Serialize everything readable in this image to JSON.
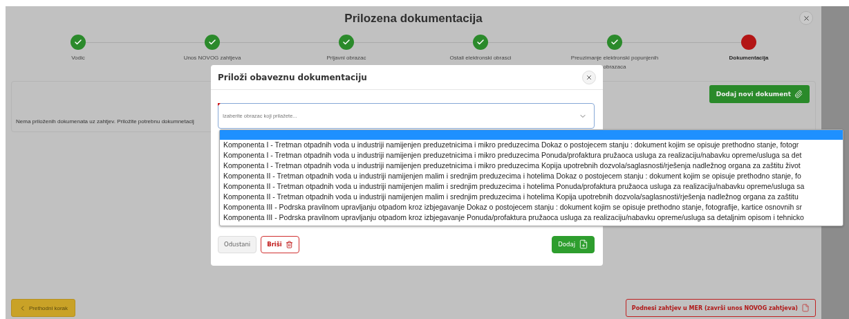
{
  "window": {
    "title": "Prilozena dokumentacija"
  },
  "steps": [
    {
      "label": "Vodic",
      "completed": true,
      "selected": false
    },
    {
      "label": "Unos NOVOG zahtjeva",
      "completed": true,
      "selected": false
    },
    {
      "label": "Prijavni obrazac",
      "completed": true,
      "selected": false
    },
    {
      "label": "Ostali elektronski obrasci",
      "completed": true,
      "selected": false
    },
    {
      "label": "Preuzimanje elektronski popunjenih obrazaca",
      "completed": true,
      "selected": false
    },
    {
      "label": "Dokumentacija",
      "completed": false,
      "selected": true
    }
  ],
  "card": {
    "add_button": "Dodaj novi dokument",
    "empty_message": "Nema priloženih dokumenata uz zahtjev. Priložite potrebnu dokumnetacij"
  },
  "dialog": {
    "title": "Priloži obaveznu dokumentaciju",
    "select": {
      "placeholder": "Izaberite obrazac koji prilažete...",
      "required": true
    },
    "options": [
      "Komponenta I - Tretman otpadnih voda u industriji namijenjen preduzetnicima i mikro preduzecima Dokaz o postojecem stanju : dokument kojim se opisuje prethodno stanje, fotogr",
      "Komponenta I - Tretman otpadnih voda u industriji namijenjen preduzetnicima i mikro preduzecima Ponuda/profaktura pružaoca usluga za realizaciju/nabavku opreme/usluga sa det",
      "Komponenta I - Tretman otpadnih voda u industriji namijenjen preduzetnicima i mikro preduzecima Kopija upotrebnih dozvola/saglasnosti/rješenja nadležnog organa za zaštitu život",
      "Komponenta II - Tretman otpadnih voda u industriji namijenjen malim i srednjim preduzecima i hotelima Dokaz o postojecem stanju : dokument kojim se opisuje prethodno stanje, fo",
      "Komponenta II - Tretman otpadnih voda u industriji namijenjen malim i srednjim preduzecima i hotelima Ponuda/profaktura pružaoca usluga za realizaciju/nabavku opreme/usluga sa",
      "Komponenta II - Tretman otpadnih voda u industriji namijenjen malim i srednjim preduzecima i hotelima Kopija upotrebnih dozvola/saglasnosti/rješenja nadležnog organa za zaštitu",
      "Komponenta III - Podrska pravilnom upravljanju otpadom kroz izbjegavanje Dokaz o postojecem stanju : dokument kojim se opisuje prethodno stanje, fotografije, kartice osnovnih sr",
      "Komponenta III - Podrska pravilnom upravljanju otpadom kroz izbjegavanje Ponuda/profaktura pružaoca usluga za realizaciju/nabavku opreme/usluga sa detaljnim opisom i tehnicko"
    ],
    "buttons": [
      {
        "label": "Odustani",
        "kind": "cancel"
      },
      {
        "label": "Briši",
        "kind": "delete"
      },
      {
        "label": "Dodaj",
        "kind": "add"
      }
    ]
  },
  "footer": {
    "back_button": "Prethodni korak",
    "submit_button": "Podnesi zahtjev u MER (završi unos NOVOG zahtjeva)"
  }
}
